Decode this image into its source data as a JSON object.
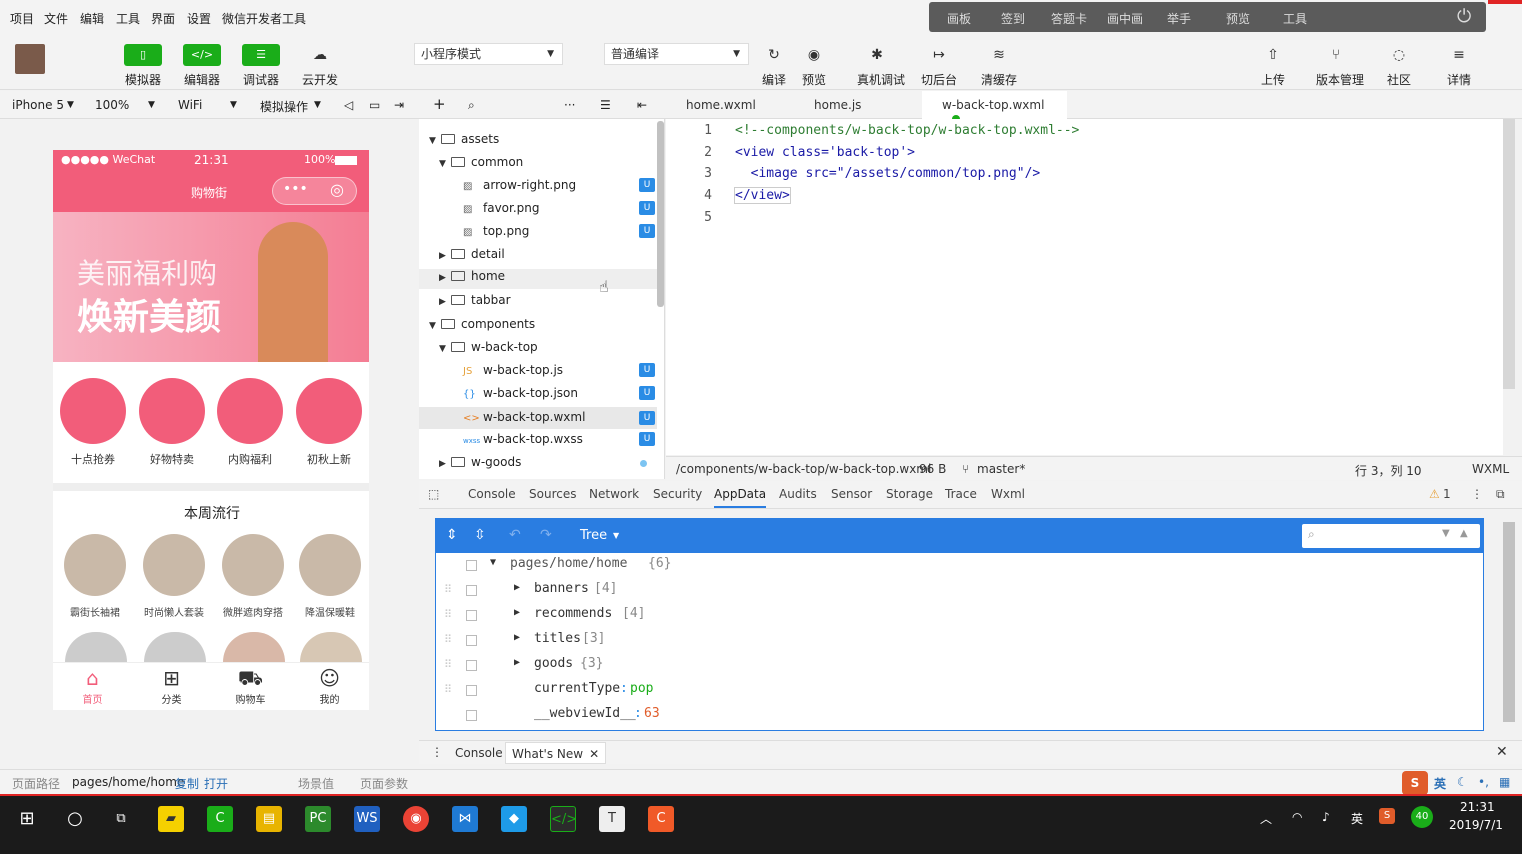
{
  "menu": [
    "项目",
    "文件",
    "编辑",
    "工具",
    "界面",
    "设置",
    "微信开发者工具"
  ],
  "topright": [
    "画板",
    "签到",
    "答题卡",
    "画中画",
    "举手",
    "预览",
    "工具"
  ],
  "toolbar": {
    "simulator": "模拟器",
    "editor": "编辑器",
    "debugger": "调试器",
    "cloud": "云开发",
    "mode": "小程序模式",
    "compile_mode": "普通编译",
    "compile": "编译",
    "preview": "预览",
    "remote_debug": "真机调试",
    "background": "切后台",
    "clear_cache": "清缓存",
    "upload": "上传",
    "version": "版本管理",
    "community": "社区",
    "details": "详情"
  },
  "subbar": {
    "device": "iPhone 5",
    "zoom": "100%",
    "network": "WiFi",
    "sim_ops": "模拟操作"
  },
  "phone": {
    "carrier": "●●●●● WeChat",
    "time": "21:31",
    "battery": "100%",
    "title": "购物街",
    "banner_line1": "美丽福利购",
    "banner_line2": "焕新美颜",
    "recommends": [
      "十点抢券",
      "好物特卖",
      "内购福利",
      "初秋上新"
    ],
    "section_title": "本周流行",
    "popular": [
      "霸街长袖裙",
      "时尚懒人套装",
      "微胖遮肉穿搭",
      "降温保暖鞋"
    ],
    "tabs": [
      "首页",
      "分类",
      "购物车",
      "我的"
    ],
    "accent": "#f25d7a"
  },
  "tree": [
    {
      "label": "assets",
      "level": 0,
      "type": "folder",
      "open": true
    },
    {
      "label": "common",
      "level": 1,
      "type": "folder",
      "open": true
    },
    {
      "label": "arrow-right.png",
      "level": 2,
      "type": "image",
      "badge": "U"
    },
    {
      "label": "favor.png",
      "level": 2,
      "type": "image",
      "badge": "U"
    },
    {
      "label": "top.png",
      "level": 2,
      "type": "image",
      "badge": "U"
    },
    {
      "label": "detail",
      "level": 1,
      "type": "folder",
      "open": false
    },
    {
      "label": "home",
      "level": 1,
      "type": "folder",
      "open": false
    },
    {
      "label": "tabbar",
      "level": 1,
      "type": "folder",
      "open": false
    },
    {
      "label": "components",
      "level": 0,
      "type": "folder",
      "open": true
    },
    {
      "label": "w-back-top",
      "level": 1,
      "type": "folder",
      "open": true
    },
    {
      "label": "w-back-top.js",
      "level": 2,
      "type": "js",
      "badge": "U"
    },
    {
      "label": "w-back-top.json",
      "level": 2,
      "type": "json",
      "badge": "U"
    },
    {
      "label": "w-back-top.wxml",
      "level": 2,
      "type": "wxml",
      "badge": "U"
    },
    {
      "label": "w-back-top.wxss",
      "level": 2,
      "type": "wxss",
      "badge": "U"
    },
    {
      "label": "w-goods",
      "level": 1,
      "type": "folder",
      "open": false
    }
  ],
  "editor_tabs": [
    "home.wxml",
    "home.js",
    "w-back-top.wxml"
  ],
  "code_lines": [
    "<!--components/w-back-top/w-back-top.wxml-->",
    "<view class='back-top'>",
    "  <image src=\"/assets/common/top.png\"/>",
    "</view>",
    ""
  ],
  "line_numbers": [
    "1",
    "2",
    "3",
    "4",
    "5"
  ],
  "status": {
    "path": "/components/w-back-top/w-back-top.wxml",
    "size": "96 B",
    "branch": "master*",
    "cursor": "行 3，列 10",
    "lang": "WXML"
  },
  "devtools_tabs": [
    "Console",
    "Sources",
    "Network",
    "Security",
    "AppData",
    "Audits",
    "Sensor",
    "Storage",
    "Trace",
    "Wxml"
  ],
  "warn_count": "1",
  "appdata": {
    "view_mode": "Tree",
    "root": "pages/home/home",
    "root_count": "{6}",
    "rows": [
      {
        "key": "banners",
        "val": "[4]"
      },
      {
        "key": "recommends",
        "val": "[4]"
      },
      {
        "key": "titles",
        "val": "[3]"
      },
      {
        "key": "goods",
        "val": "{3}"
      }
    ],
    "current_type_key": "currentType",
    "current_type_val": "pop",
    "webview_key": "__webviewId__",
    "webview_val": "63"
  },
  "console_bar": {
    "console": "Console",
    "whats_new": "What's New"
  },
  "pathbar": {
    "label": "页面路径",
    "path": "pages/home/home",
    "copy": "复制",
    "open": "打开",
    "scene": "场景值",
    "params": "页面参数"
  },
  "clock": {
    "time": "21:31",
    "date": "2019/7/1"
  },
  "ime": "英",
  "tray_badge": "40"
}
